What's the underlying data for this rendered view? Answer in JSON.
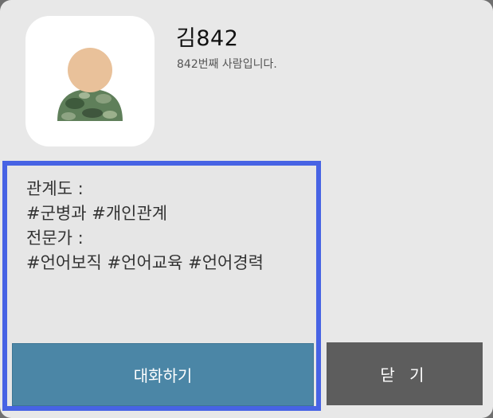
{
  "profile": {
    "name": "김842",
    "subtitle": "842번째 사람입니다.",
    "avatar_icon": "soldier-avatar-icon"
  },
  "info": {
    "relation_label": "관계도 :",
    "relation_tags": "#군병과 #개인관계",
    "expertise_label": "전문가 :",
    "expertise_tags": "#언어보직 #언어교육 #언어경력"
  },
  "buttons": {
    "chat_label": "대화하기",
    "close_label": "닫 기"
  },
  "colors": {
    "highlight_border": "#4763e4",
    "chat_button": "#4b86a6",
    "close_button": "#5d5d5d",
    "dialog_bg": "#e8e8e8"
  }
}
